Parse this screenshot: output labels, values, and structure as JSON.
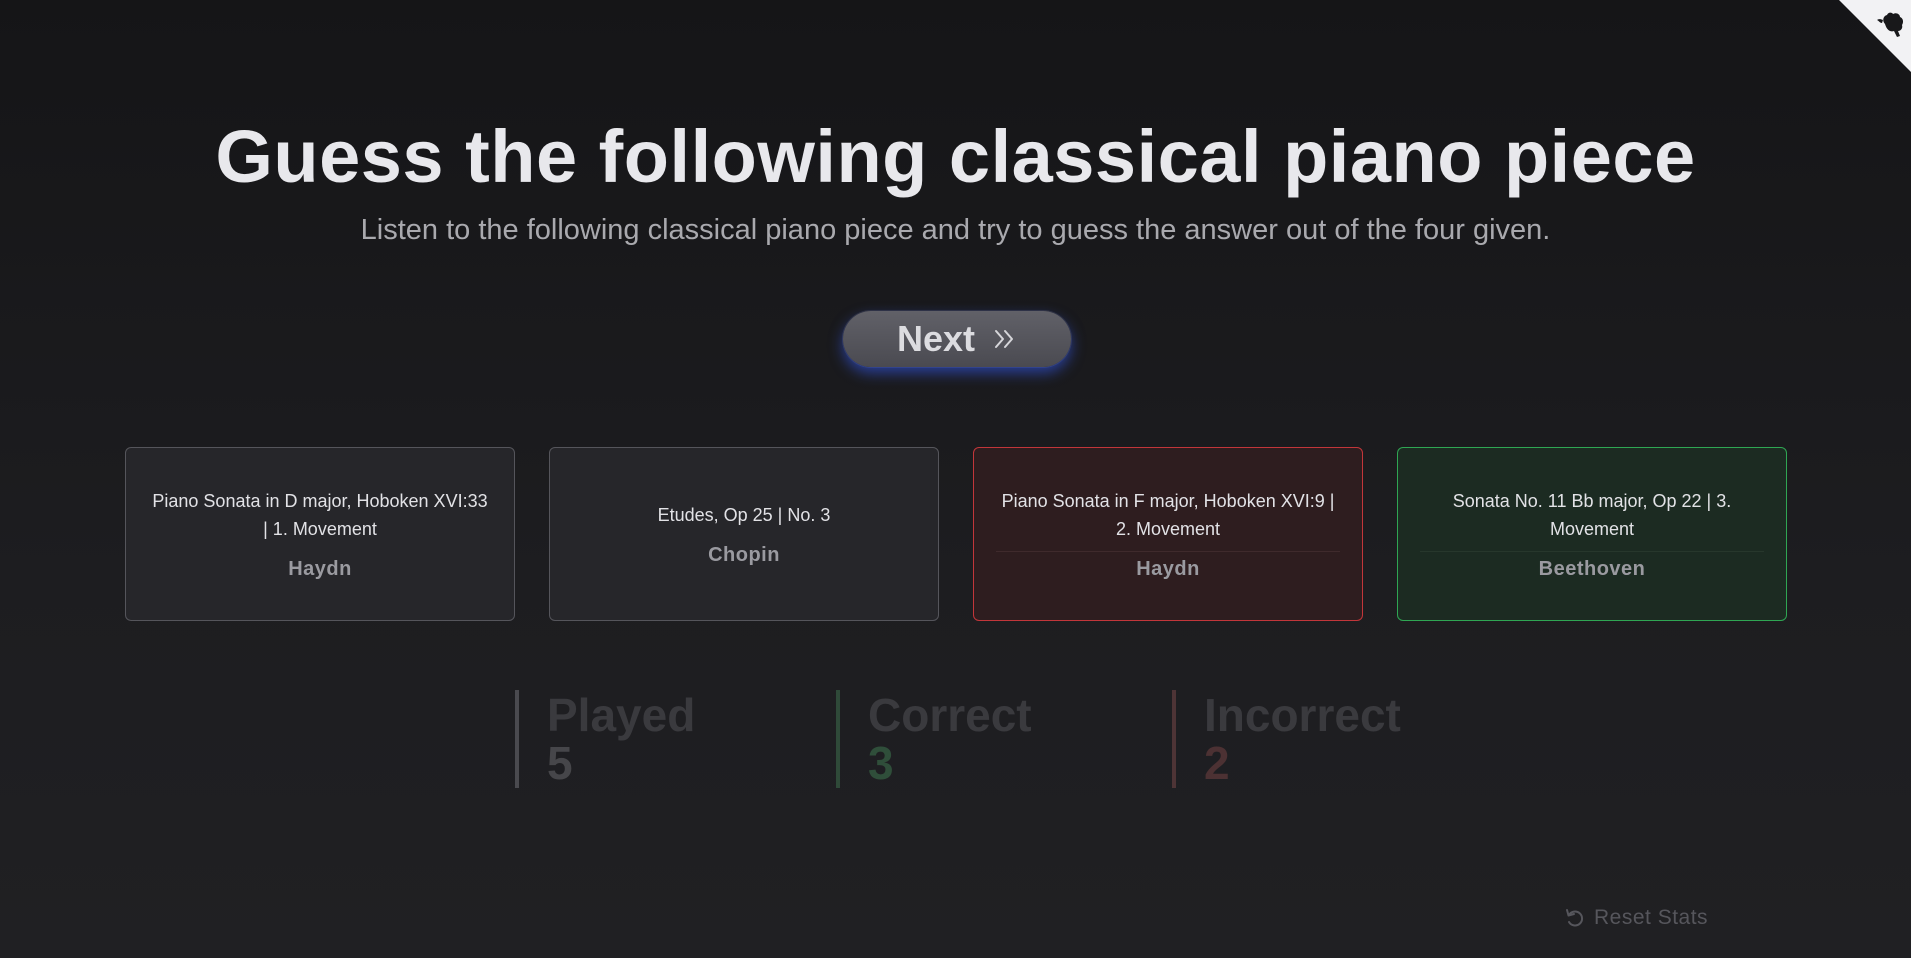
{
  "header": {
    "title": "Guess the following classical piano piece",
    "subtitle": "Listen to the following classical piano piece and try to guess the answer out of the four given."
  },
  "next_button": {
    "label": "Next",
    "icon": "double-chevron-right-icon"
  },
  "options": [
    {
      "piece": "Piano Sonata in D major, Hoboken XVI:33 | 1. Movement",
      "composer": "Haydn",
      "state": "neutral"
    },
    {
      "piece": "Etudes, Op 25 | No. 3",
      "composer": "Chopin",
      "state": "neutral"
    },
    {
      "piece": "Piano Sonata in F major, Hoboken XVI:9 | 2. Movement",
      "composer": "Haydn",
      "state": "incorrect"
    },
    {
      "piece": "Sonata No. 11 Bb major, Op 22 | 3. Movement",
      "composer": "Beethoven",
      "state": "correct"
    }
  ],
  "stats": {
    "played": {
      "label": "Played",
      "value": "5"
    },
    "correct": {
      "label": "Correct",
      "value": "3"
    },
    "incorrect": {
      "label": "Incorrect",
      "value": "2"
    }
  },
  "reset": {
    "label": "Reset Stats",
    "icon": "reset-icon"
  },
  "corner_icon": "github-octocat-icon",
  "colors": {
    "correct": "#2fa653",
    "incorrect": "#c2363a",
    "button_glow": "#375fff"
  }
}
